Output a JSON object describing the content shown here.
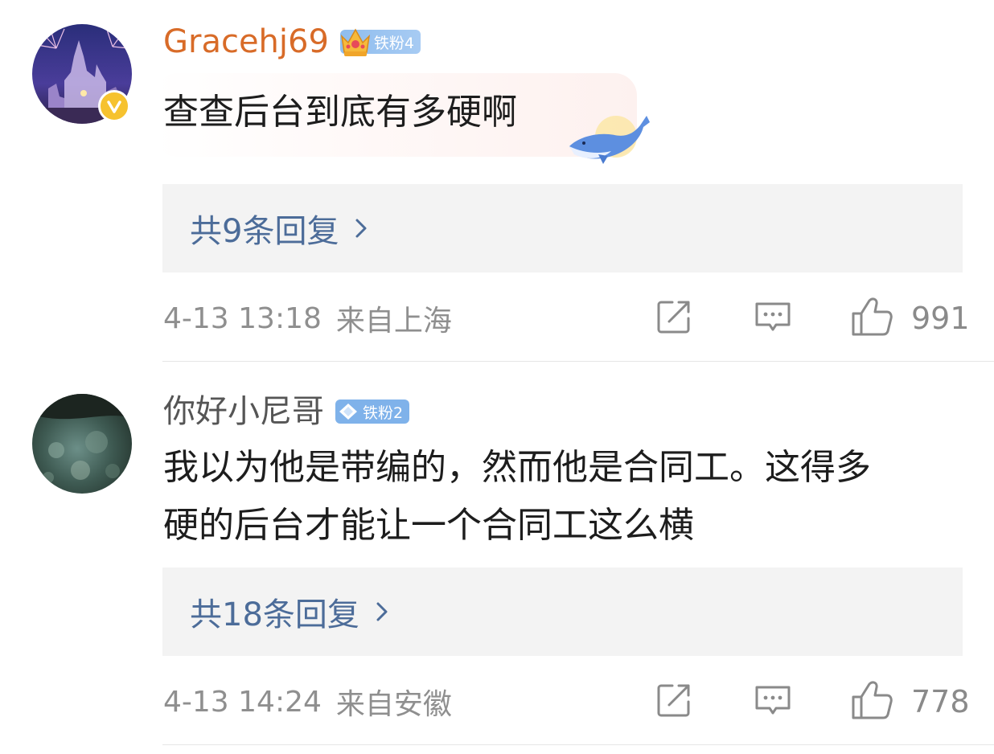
{
  "comments": [
    {
      "username": "Gracehj69",
      "fan_badge": "铁粉4",
      "text": "查查后台到底有多硬啊",
      "replies": "共9条回复",
      "time": "4-13 13:18",
      "location": "来自上海",
      "likes": "991"
    },
    {
      "username": "你好小尼哥",
      "fan_badge": "铁粉2",
      "text_line1": "我以为他是带编的，然而他是合同工。这得多",
      "text_line2": "硬的后台才能让一个合同工这么横",
      "replies": "共18条回复",
      "time": "4-13 14:24",
      "location": "来自安徽",
      "likes": "778"
    }
  ],
  "colors": {
    "username_highlight": "#d86b28",
    "reply_link": "#4c6c99",
    "meta_gray": "#8f8f8f",
    "fan_badge": "#7fb2ea",
    "verified_badge": "#f6c22f"
  },
  "icons": [
    "verified-v-icon",
    "crown-icon",
    "diamond-icon",
    "whale-icon",
    "chevron-right-icon",
    "share-icon",
    "comment-icon",
    "like-icon"
  ]
}
